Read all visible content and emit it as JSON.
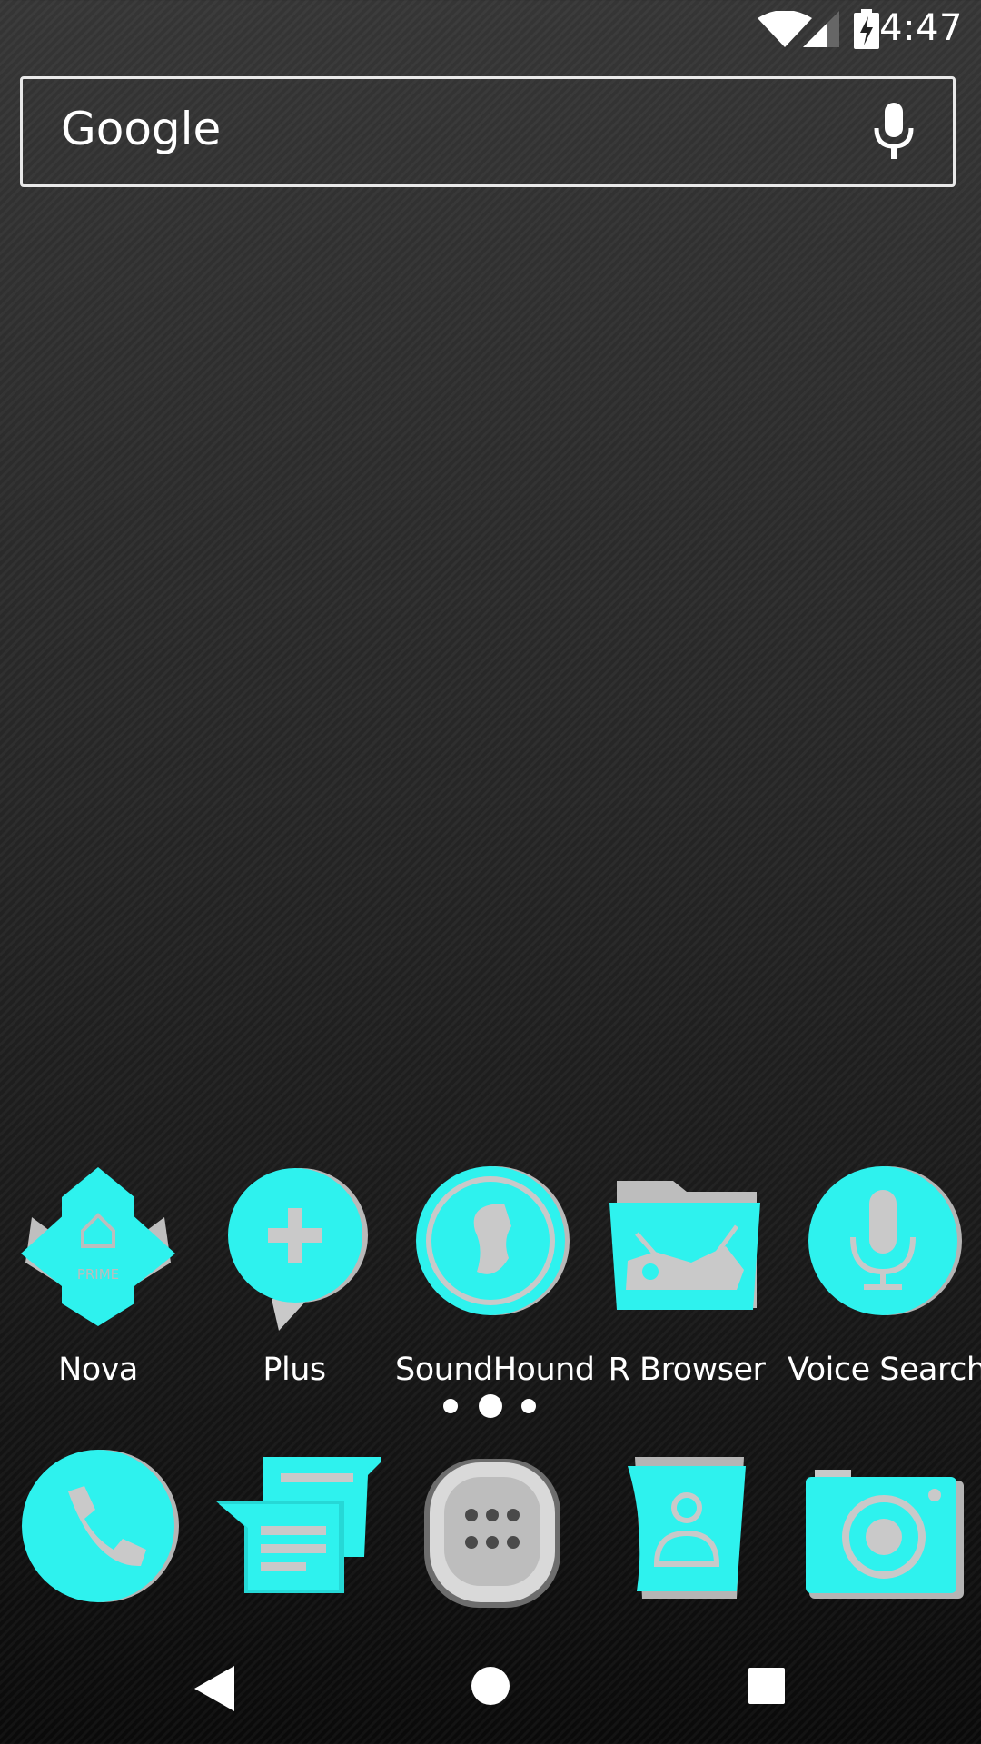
{
  "status_bar": {
    "time": "4:47",
    "icons": [
      "wifi-icon",
      "cell-signal-icon",
      "battery-charging-icon"
    ]
  },
  "search_bar": {
    "logo": "Google",
    "mic_icon": "microphone-icon"
  },
  "home_apps": [
    {
      "label": "Nova",
      "icon": "nova-prime-icon"
    },
    {
      "label": "Plus",
      "icon": "plus-bubble-icon"
    },
    {
      "label": "SoundHound",
      "icon": "soundhound-icon"
    },
    {
      "label": "R Browser",
      "icon": "folder-icon"
    },
    {
      "label": "Voice Search",
      "icon": "microphone-icon"
    }
  ],
  "page_indicator": {
    "pages": 3,
    "current": 2
  },
  "dock_apps": [
    {
      "name": "phone",
      "icon": "phone-icon"
    },
    {
      "name": "messages",
      "icon": "messages-icon"
    },
    {
      "name": "app-drawer",
      "icon": "app-drawer-icon"
    },
    {
      "name": "contacts",
      "icon": "contacts-icon"
    },
    {
      "name": "camera",
      "icon": "camera-icon"
    }
  ],
  "nav_bar": {
    "icons": [
      "back-icon",
      "home-icon",
      "recents-icon"
    ]
  },
  "colors": {
    "accent": "#2ef2ee",
    "silver": "#c9c9c9"
  }
}
